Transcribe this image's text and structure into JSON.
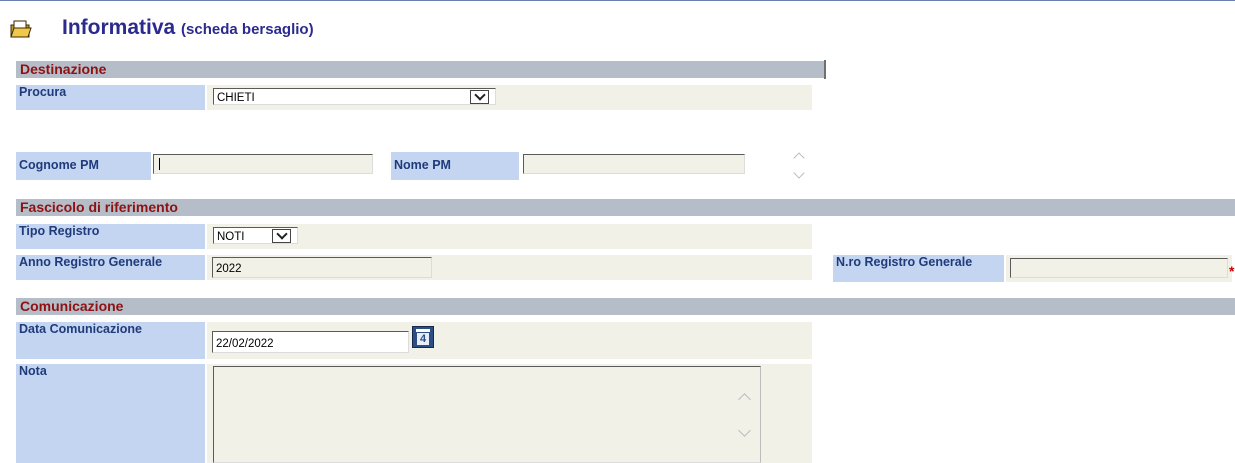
{
  "header": {
    "title": "Informativa",
    "subtitle": "(scheda bersaglio)",
    "icon": "open-folder-icon"
  },
  "sections": {
    "destinazione": "Destinazione",
    "fascicolo": "Fascicolo di riferimento",
    "comunicazione": "Comunicazione"
  },
  "destinazione": {
    "procura_label": "Procura",
    "procura_value": "CHIETI",
    "cognome_pm_label": "Cognome PM",
    "cognome_pm_value": "",
    "nome_pm_label": "Nome PM",
    "nome_pm_value": ""
  },
  "fascicolo": {
    "tipo_registro_label": "Tipo Registro",
    "tipo_registro_value": "NOTI",
    "anno_label": "Anno Registro Generale",
    "anno_value": "2022",
    "nro_label": "N.ro Registro Generale",
    "nro_value": "",
    "required_mark": "*"
  },
  "comunicazione": {
    "data_label": "Data Comunicazione",
    "data_value": "22/02/2022",
    "calendar_day": "4",
    "nota_label": "Nota",
    "nota_value": ""
  },
  "colors": {
    "title": "#2b2b8f",
    "section_text": "#8e1212",
    "section_bg": "#b5bdc9",
    "label_bg": "#c4d5f2",
    "field_bg": "#f2f1e8"
  }
}
